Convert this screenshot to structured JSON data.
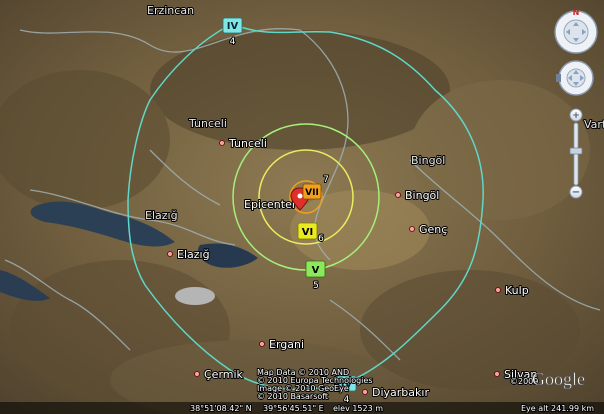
{
  "regions": {
    "erzincan": "Erzincan",
    "tunceli": "Tunceli",
    "bingol": "Bingöl",
    "elazig": "Elazığ",
    "varto": "Varto"
  },
  "cities": {
    "tunceli": "Tunceli",
    "bingol": "Bingöl",
    "genc": "Genç",
    "elazig": "Elazığ",
    "kulp": "Kulp",
    "ergani": "Ergani",
    "cermik": "Çermik",
    "diyarbakir": "Diyarbakır",
    "silvan": "Silvan"
  },
  "epicenter_label": "Epicenter",
  "intensity_markers": {
    "iv_top": {
      "numeral": "IV",
      "value": "4"
    },
    "iv_bottom": {
      "numeral": "IV",
      "value": "4"
    },
    "v": {
      "numeral": "V",
      "value": "5"
    },
    "vi": {
      "numeral": "VI",
      "value": "6"
    },
    "vii": {
      "numeral": "VII",
      "value": "7"
    }
  },
  "rings": {
    "iv": {
      "color": "#5fd8c8"
    },
    "v": {
      "color": "#a6f07a"
    },
    "vi": {
      "color": "#e8ee60"
    },
    "vii": {
      "color": "#f0a020"
    }
  },
  "marker_colors": {
    "iv": "#7fe6e6",
    "v": "#8ce85a",
    "vi": "#eaea20",
    "vii": "#f0a020"
  },
  "status_bar": {
    "coordinates": "38°51'08.42\" N",
    "longitude": "39°56'45.51\" E",
    "elevation": "elev 1523 m",
    "eye_altitude": "Eye alt 241.99 km"
  },
  "attribution": {
    "line1": "Map Data © 2010 AND",
    "line2": "© 2010 Europa Technologies",
    "line3": "Image © 2010 GeoEye",
    "line4": "© 2010 Basarsoft",
    "year": "©2009"
  },
  "logo": "Google"
}
